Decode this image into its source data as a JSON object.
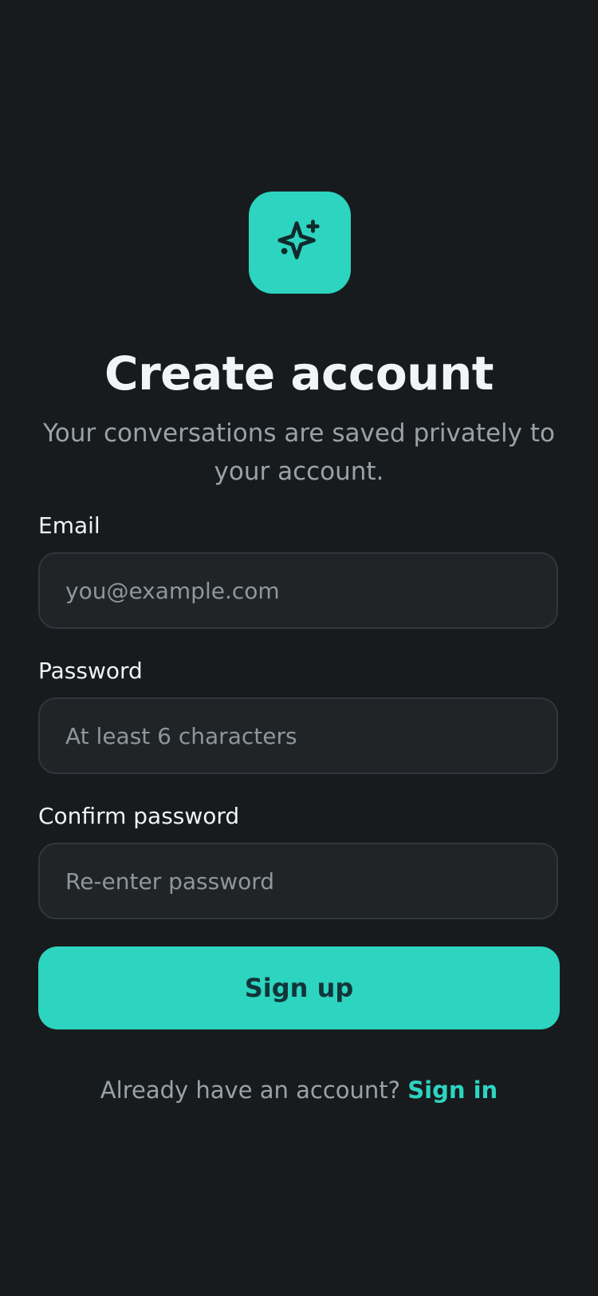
{
  "app": {
    "title": "Create account",
    "subtitle": "Your conversations are saved privately to your account.",
    "logo_icon": "sparkles-icon"
  },
  "form": {
    "email": {
      "label": "Email",
      "value": "",
      "placeholder": "you@example.com"
    },
    "password": {
      "label": "Password",
      "value": "",
      "placeholder": "At least 6 characters"
    },
    "confirm_password": {
      "label": "Confirm password",
      "value": "",
      "placeholder": "Re-enter password"
    },
    "submit_label": "Sign up"
  },
  "footer": {
    "prompt": "Already have an account?",
    "signin_label": "Sign in"
  },
  "colors": {
    "background": "#171b1e",
    "accent": "#2dd4bf",
    "input_background": "#202427",
    "muted_text": "#9aa2a7"
  }
}
